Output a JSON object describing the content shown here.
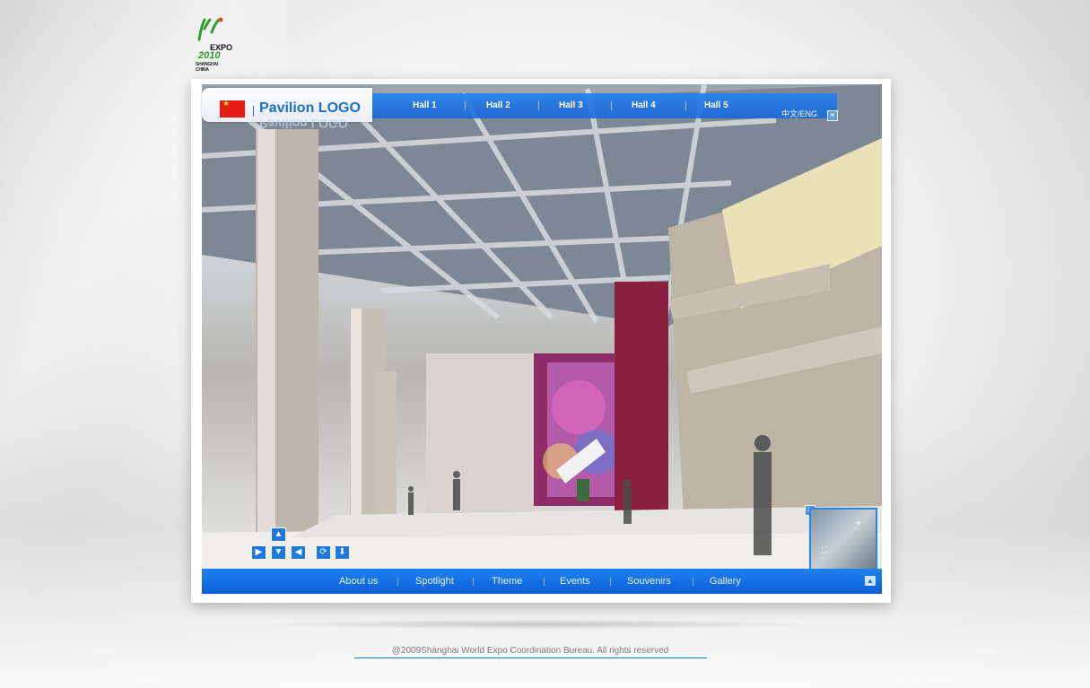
{
  "expo_logo": {
    "line1": "EXPO",
    "line2": "2010",
    "subtitle": "SHANGHAI CHINA"
  },
  "header": {
    "pavilion_logo": "Pavilion LOGO",
    "halls": [
      "Hall 1",
      "Hall 2",
      "Hall 3",
      "Hall 4",
      "Hall 5"
    ],
    "language_toggle": "中文/ENG",
    "close_icon": "close-icon"
  },
  "navigation_controls": {
    "icons": [
      "arrow-up-icon",
      "arrow-right-icon",
      "arrow-down-icon",
      "arrow-left-icon",
      "rotate-icon",
      "download-icon"
    ]
  },
  "minimap": {
    "close_icon": "close-icon",
    "zoom_icon": "plus-icon",
    "fit_icon": "fit-icon"
  },
  "bottom_nav": {
    "items": [
      "About us",
      "Spotlight",
      "Theme",
      "Events",
      "Souvenirs",
      "Gallery"
    ],
    "scroll_top_icon": "chevron-up-icon"
  },
  "footer": {
    "copyright": "@2009Shanghai World Expo Coordination Bureau. All rights reserved"
  },
  "colors": {
    "accent": "#1f82f0",
    "flag_red": "#e41b17",
    "logo_blue": "#1c6fd0"
  }
}
